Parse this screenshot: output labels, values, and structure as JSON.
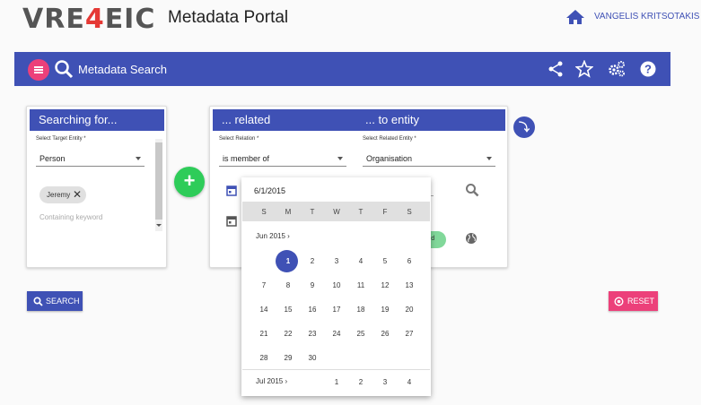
{
  "header": {
    "logo_parts": [
      "VRE",
      "4",
      "EIC"
    ],
    "portal_title": "Metadata Portal",
    "user_name": "VANGELIS KRITSOTAKIS"
  },
  "toolbar": {
    "title": "Metadata Search",
    "icons": [
      "share-icon",
      "star-icon",
      "settings-icon",
      "help-icon"
    ]
  },
  "search_card": {
    "header": "Searching for...",
    "target_entity_label": "Select Target Entity *",
    "target_entity_value": "Person",
    "chip_label": "Jeremy",
    "keyword_placeholder": "Containing keyword"
  },
  "related_card": {
    "header_related": "... related",
    "header_entity": "... to entity",
    "relation_label": "Select Relation *",
    "relation_value": "is member of",
    "related_entity_label": "Select Related Entity *",
    "related_entity_value": "Organisation",
    "keyword_chip_fragment": "ord"
  },
  "datepicker": {
    "selected_date": "6/1/2015",
    "weekdays": [
      "S",
      "M",
      "T",
      "W",
      "T",
      "F",
      "S"
    ],
    "month_label": "Jun 2015",
    "weeks": [
      [
        "",
        "1",
        "2",
        "3",
        "4",
        "5",
        "6"
      ],
      [
        "7",
        "8",
        "9",
        "10",
        "11",
        "12",
        "13"
      ],
      [
        "14",
        "15",
        "16",
        "17",
        "18",
        "19",
        "20"
      ],
      [
        "21",
        "22",
        "23",
        "24",
        "25",
        "26",
        "27"
      ],
      [
        "28",
        "29",
        "30",
        "",
        "",
        "",
        ""
      ]
    ],
    "next_month_label": "Jul 2015",
    "next_month_days": [
      "1",
      "2",
      "3",
      "4"
    ]
  },
  "buttons": {
    "search": "SEARCH",
    "reset": "RESET",
    "add": "+"
  },
  "colors": {
    "primary": "#3f51b5",
    "accent": "#ec407a",
    "add": "#2ecc59"
  }
}
